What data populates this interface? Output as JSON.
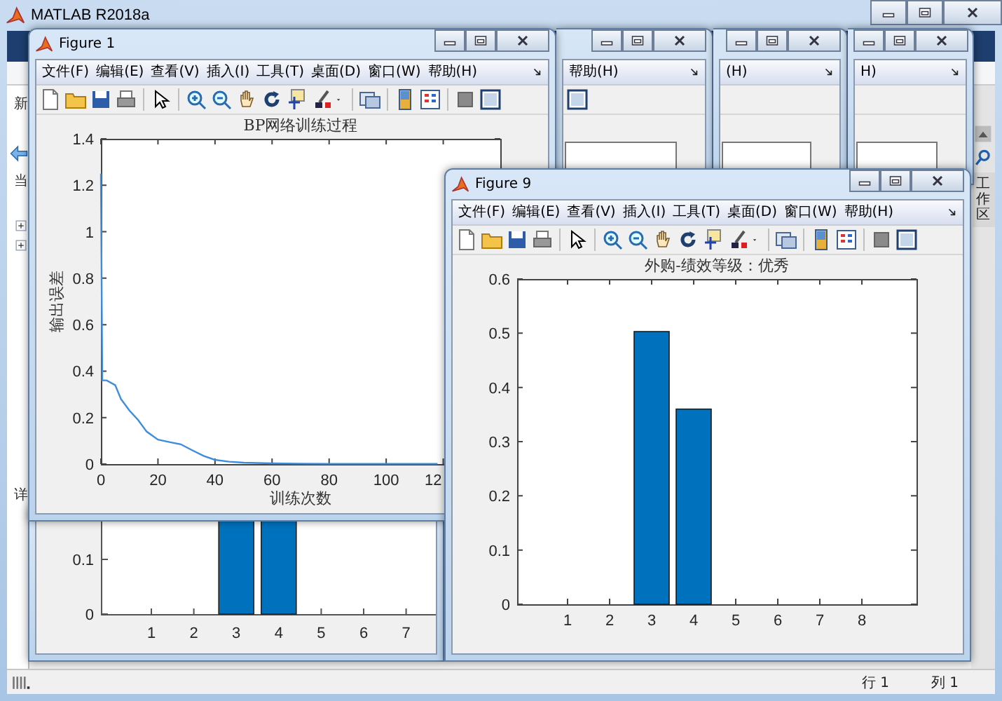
{
  "window": {
    "title": "MATLAB R2018a"
  },
  "left_panel": {
    "ribbon_label": "新",
    "folder_label": "当",
    "tree_nodes": [
      {
        "expanded": false
      },
      {
        "expanded": false
      }
    ],
    "details_label": "详"
  },
  "background_figures": [
    {
      "menu_text": "帮助(H)",
      "toolbar_icon": true
    },
    {
      "menu_text": "(H)",
      "toolbar_icon": false
    },
    {
      "menu_text": "H)",
      "toolbar_icon": false
    }
  ],
  "partial_figure": {
    "yticks": [
      "0.1",
      "0"
    ],
    "xticks": [
      {
        "label": "1",
        "bar": false
      },
      {
        "label": "2",
        "bar": false
      },
      {
        "label": "3",
        "bar": true
      },
      {
        "label": "4",
        "bar": true
      },
      {
        "label": "5",
        "bar": false
      },
      {
        "label": "6",
        "bar": false
      },
      {
        "label": "7",
        "bar": false
      }
    ]
  },
  "figures": [
    {
      "title": "Figure 1",
      "menu": [
        "文件(F)",
        "编辑(E)",
        "查看(V)",
        "插入(I)",
        "工具(T)",
        "桌面(D)",
        "窗口(W)",
        "帮助(H)"
      ],
      "chart_data": {
        "type": "line",
        "title": "BP网络训练过程",
        "xlabel": "训练次数",
        "ylabel": "输出误差",
        "x": [
          0,
          0.5,
          2,
          5,
          7,
          10,
          13,
          16,
          20,
          24,
          28,
          32,
          36,
          40,
          45,
          50,
          60,
          70,
          80,
          100,
          118
        ],
        "series": [
          {
            "color": "#3d8ddc",
            "values": [
              1.25,
              0.36,
              0.36,
              0.34,
              0.28,
              0.23,
              0.19,
              0.14,
              0.105,
              0.095,
              0.085,
              0.06,
              0.035,
              0.018,
              0.01,
              0.006,
              0.003,
              0.002,
              0.001,
              0.001,
              0.001
            ]
          }
        ],
        "xlim": [
          0,
          140
        ],
        "ylim": [
          0,
          1.4
        ],
        "xticks": [
          0,
          20,
          40,
          60,
          80,
          100
        ],
        "yticks": [
          0,
          0.2,
          0.4,
          0.6,
          0.8,
          1,
          1.2,
          1.4
        ]
      },
      "clipped_tick_label": "12"
    },
    {
      "title": "Figure 9",
      "menu": [
        "文件(F)",
        "编辑(E)",
        "查看(V)",
        "插入(I)",
        "工具(T)",
        "桌面(D)",
        "窗口(W)",
        "帮助(H)"
      ],
      "chart_data": {
        "type": "bar",
        "title": "外购-绩效等级：优秀",
        "categories": [
          "1",
          "2",
          "3",
          "4",
          "5",
          "6",
          "7",
          "8"
        ],
        "series": [
          {
            "color": "#0072bd",
            "values": [
              0,
              0,
              0.503,
              0.36,
              0,
              0,
              0,
              0
            ]
          }
        ],
        "ylim": [
          0,
          0.6
        ],
        "yticks": [
          0,
          0.1,
          0.2,
          0.3,
          0.4,
          0.5,
          0.6
        ]
      }
    }
  ],
  "right_panel": {
    "tab": "工作区"
  },
  "status_bar": {
    "row": "行 1",
    "column": "列 1"
  }
}
